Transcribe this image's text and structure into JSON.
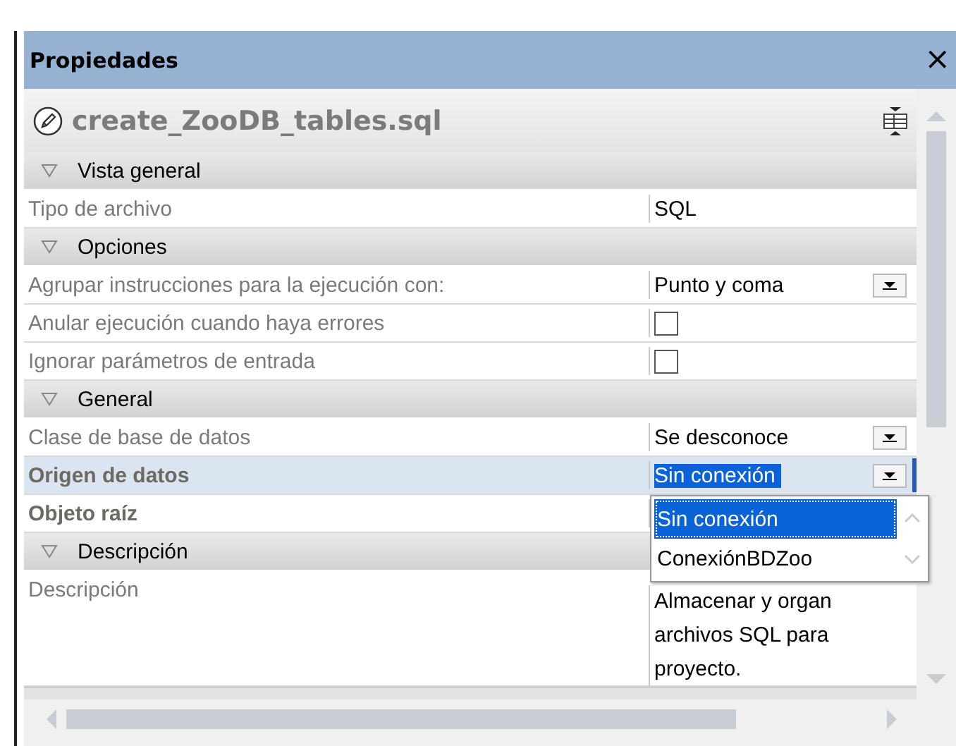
{
  "panel": {
    "title": "Propiedades",
    "close": "×",
    "file_name": "create_ZooDB_tables.sql"
  },
  "rows": [
    {
      "kind": "section",
      "label": "Vista general",
      "expanded": true
    },
    {
      "kind": "text",
      "label": "Tipo de archivo",
      "value": "SQL",
      "bold": false,
      "selected": false
    },
    {
      "kind": "section",
      "label": "Opciones",
      "expanded": true
    },
    {
      "kind": "dropdown",
      "label": "Agrupar instrucciones para la ejecución con:",
      "value": "Punto y coma",
      "bold": false,
      "selected": false
    },
    {
      "kind": "checkbox",
      "label": "Anular ejecución cuando haya errores",
      "checked": false,
      "bold": false,
      "selected": false
    },
    {
      "kind": "checkbox",
      "label": "Ignorar parámetros de entrada",
      "checked": false,
      "bold": false,
      "selected": false
    },
    {
      "kind": "section",
      "label": "General",
      "expanded": true
    },
    {
      "kind": "dropdown",
      "label": "Clase de base de datos",
      "value": "Se desconoce",
      "bold": false,
      "selected": false
    },
    {
      "kind": "dropdown",
      "label": "Origen de datos",
      "value": "Sin conexión",
      "bold": true,
      "selected": true,
      "open": true,
      "options": [
        {
          "label": "Sin conexión",
          "selected": true
        },
        {
          "label": "ConexiónBDZoo",
          "selected": false
        }
      ]
    },
    {
      "kind": "text",
      "label": "Objeto raíz",
      "value": "",
      "bold": true,
      "selected": false
    },
    {
      "kind": "section",
      "label": "Descripción",
      "expanded": true
    },
    {
      "kind": "multiline",
      "label": "Descripción",
      "lines": [
        "Almacenar y organ",
        "archivos SQL para",
        "proyecto."
      ],
      "bold": false,
      "selected": false
    }
  ]
}
